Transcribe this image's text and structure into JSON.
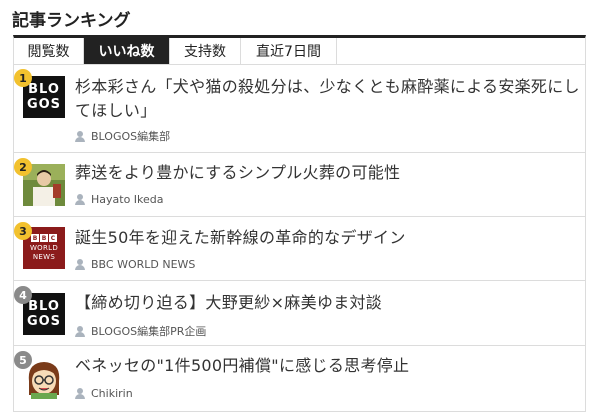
{
  "section": {
    "title": "記事ランキング"
  },
  "tabs": [
    {
      "label": "閲覧数"
    },
    {
      "label": "いいね数"
    },
    {
      "label": "支持数"
    },
    {
      "label": "直近7日間"
    }
  ],
  "articles": [
    {
      "rank": "1",
      "title_line1": "杉本彩さん「犬や猫の殺処分は、少なくとも麻酔薬による安楽死にし",
      "title_line2": "てほしい」",
      "author": "BLOGOS編集部",
      "thumb": {
        "type": "blogos",
        "line1": "BLO",
        "line2": "GOS"
      }
    },
    {
      "rank": "2",
      "title_line1": "葬送をより豊かにするシンプル火葬の可能性",
      "author": "Hayato Ikeda",
      "thumb": {
        "type": "photo"
      }
    },
    {
      "rank": "3",
      "title_line1": "誕生50年を迎えた新幹線の革命的なデザイン",
      "author": "BBC WORLD NEWS",
      "thumb": {
        "type": "bbc",
        "blocks": [
          "B",
          "B",
          "C"
        ],
        "line1": "WORLD",
        "line2": "NEWS"
      }
    },
    {
      "rank": "4",
      "title_line1": "【締め切り迫る】大野更紗×麻美ゆま対談",
      "author": "BLOGOS編集部PR企画",
      "thumb": {
        "type": "blogos",
        "line1": "BLO",
        "line2": "GOS"
      }
    },
    {
      "rank": "5",
      "title_line1": "ベネッセの\"1件500円補償\"に感じる思考停止",
      "author": "Chikirin",
      "thumb": {
        "type": "cartoon"
      }
    }
  ],
  "colors": {
    "rank_top": "#f2c12e",
    "rank_other": "#8a8a8a",
    "tab_active": "#222222"
  }
}
